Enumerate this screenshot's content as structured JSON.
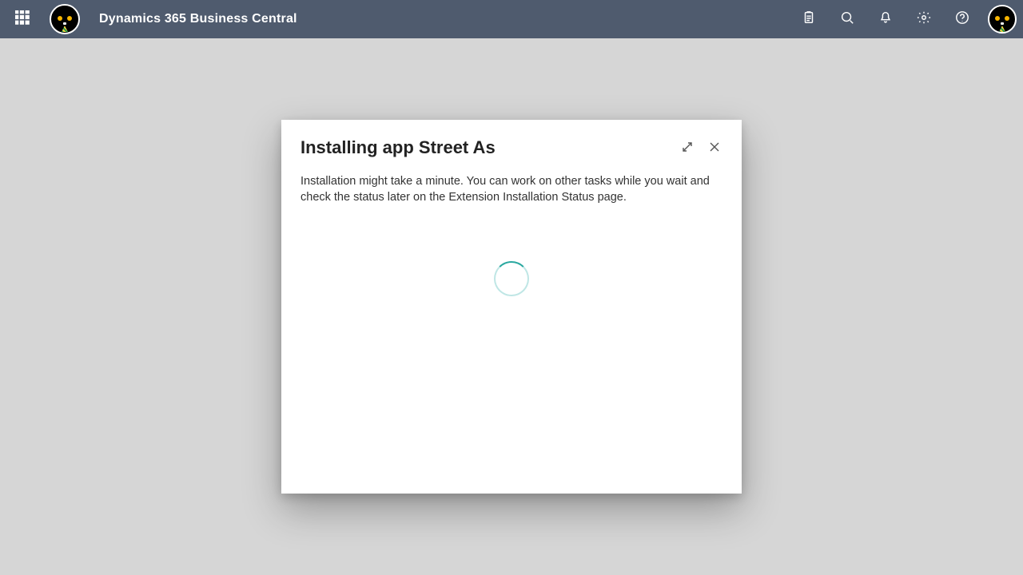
{
  "header": {
    "brand": "Dynamics 365 Business Central"
  },
  "dialog": {
    "title": "Installing app Street As",
    "message": "Installation might take a minute. You can work on other tasks while you wait and check the status later on the Extension Installation Status page."
  }
}
